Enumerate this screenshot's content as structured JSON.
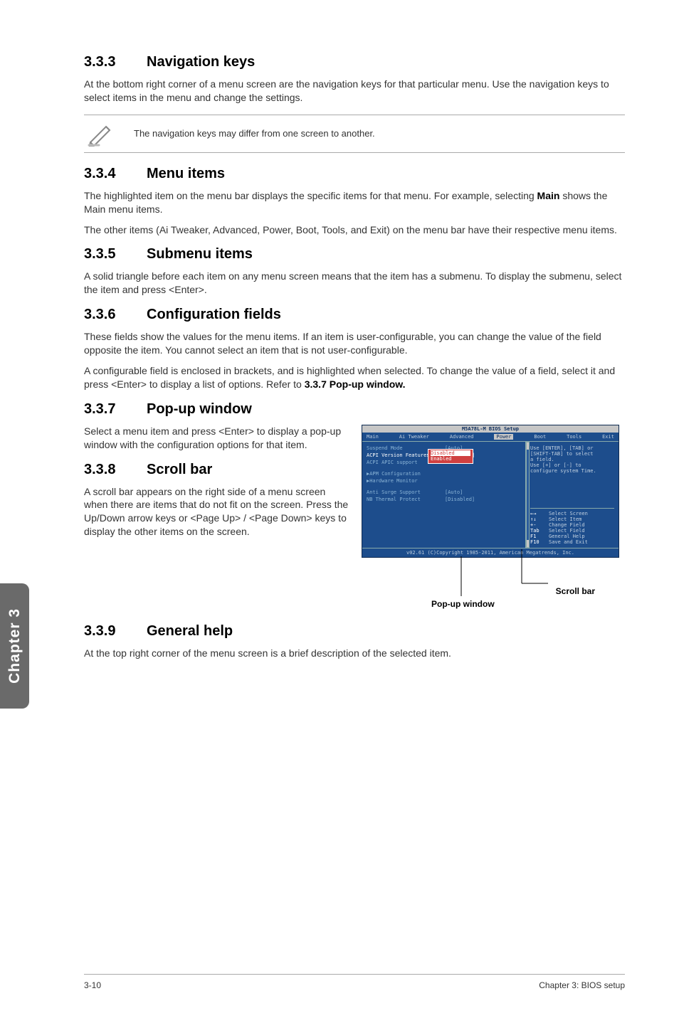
{
  "sections": {
    "s333": {
      "num": "3.3.3",
      "title": "Navigation keys",
      "p1": "At the bottom right corner of a menu screen are the navigation keys for that particular menu. Use the navigation keys to select items in the menu and change the settings."
    },
    "note333": "The navigation keys may differ from one screen to another.",
    "s334": {
      "num": "3.3.4",
      "title": "Menu items",
      "p1a": "The highlighted item on the menu bar displays the specific items for that menu. For example, selecting ",
      "p1b": "Main",
      "p1c": " shows the Main menu items.",
      "p2": "The other items (Ai Tweaker, Advanced, Power, Boot, Tools, and Exit) on the menu bar have their respective menu items."
    },
    "s335": {
      "num": "3.3.5",
      "title": "Submenu items",
      "p1": "A solid triangle before each item on any menu screen means that the item has a submenu. To display the submenu, select the item and press <Enter>."
    },
    "s336": {
      "num": "3.3.6",
      "title": "Configuration fields",
      "p1": "These fields show the values for the menu items. If an item is user-configurable, you can change the value of the field opposite the item. You cannot select an item that is not user-configurable.",
      "p2a": "A configurable field is enclosed in brackets, and is highlighted when selected. To change the value of a field, select it and press <Enter> to display a list of options. Refer to ",
      "p2b": "3.3.7 Pop-up window."
    },
    "s337": {
      "num": "3.3.7",
      "title": "Pop-up window",
      "p1": "Select a menu item and press <Enter> to display a pop-up window with the configuration options for that item."
    },
    "s338": {
      "num": "3.3.8",
      "title": "Scroll bar",
      "p1": "A scroll bar appears on the right side of a menu screen when there are items that do not fit on the screen. Press the Up/Down arrow keys or <Page Up> / <Page Down> keys to display the other items on the screen."
    },
    "s339": {
      "num": "3.3.9",
      "title": "General help",
      "p1": "At the top right corner of the menu screen is a brief description of the selected item."
    }
  },
  "bios": {
    "title": "M5A78L-M BIOS Setup",
    "menu": [
      "Main",
      "Ai Tweaker",
      "Advanced",
      "Power",
      "Boot",
      "Tools",
      "Exit"
    ],
    "rows": [
      {
        "label": "Suspend Mode",
        "value": "[Auto]"
      },
      {
        "label": "ACPI Version Features",
        "value": "[Disabled]"
      },
      {
        "label": "ACPI APIC support",
        "value": ""
      },
      {
        "label": "APM Configuration",
        "tri": true
      },
      {
        "label": "Hardware Monitor",
        "tri": true
      },
      {
        "label": "Anti Surge Support",
        "value": "[Auto]"
      },
      {
        "label": "NB Thermal Protect",
        "value": "[Disabled]"
      }
    ],
    "popup": [
      "Disabled",
      "Enabled"
    ],
    "help_top": [
      "Use [ENTER], [TAB] or",
      "[SHIFT-TAB] to select",
      "a field.",
      "",
      "Use [+] or [-] to",
      "configure system Time."
    ],
    "help_keys": [
      {
        "k": "←→",
        "d": "Select Screen"
      },
      {
        "k": "↑↓",
        "d": "Select Item"
      },
      {
        "k": "+-",
        "d": "Change Field"
      },
      {
        "k": "Tab",
        "d": "Select Field"
      },
      {
        "k": "F1",
        "d": "General Help"
      },
      {
        "k": "F10",
        "d": "Save and Exit"
      }
    ],
    "copyright": "v02.61 (C)Copyright 1985-2011, American Megatrends, Inc."
  },
  "fig_labels": {
    "scroll": "Scroll bar",
    "popup": "Pop-up window"
  },
  "sidebar": "Chapter 3",
  "footer": {
    "left": "3-10",
    "right": "Chapter 3: BIOS setup"
  }
}
